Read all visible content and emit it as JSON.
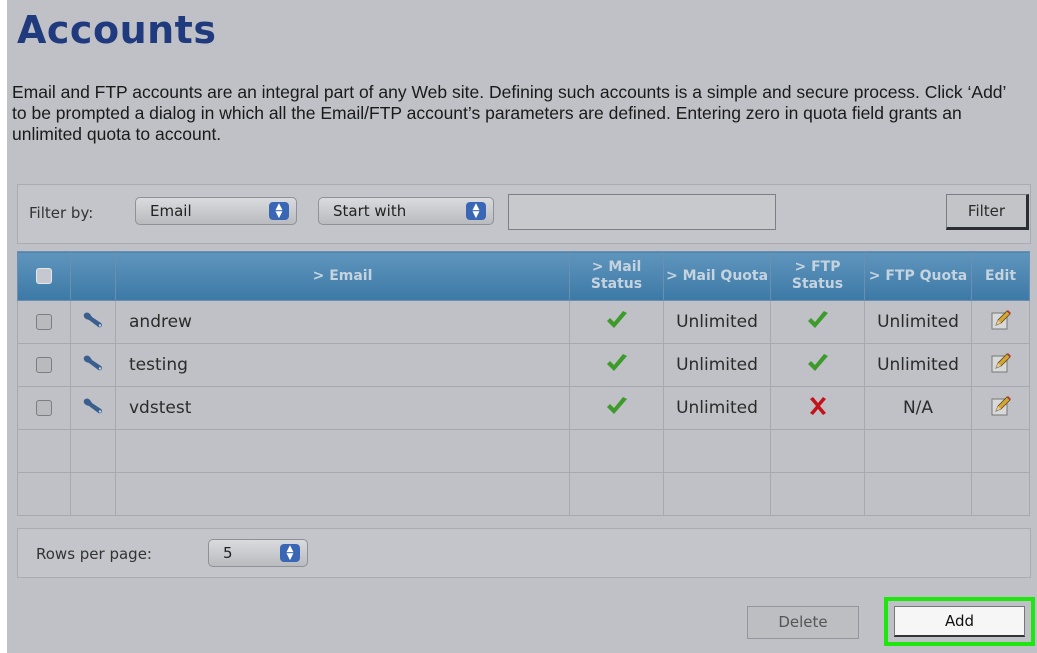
{
  "page": {
    "title": "Accounts",
    "intro": "Email and FTP accounts are an integral part of any Web site. Defining such accounts is a simple and secure process. Click ‘Add’ to be prompted a dialog in which all the Email/FTP account’s parameters are defined. Entering zero in quota field grants an unlimited quota to account."
  },
  "filter": {
    "label": "Filter by:",
    "field_select": "Email",
    "mode_select": "Start with",
    "text_value": "",
    "button_label": "Filter"
  },
  "table": {
    "headers": {
      "email": "Email",
      "mail_status": "Mail Status",
      "mail_quota": "Mail Quota",
      "ftp_status": "FTP Status",
      "ftp_quota": "FTP Quota",
      "edit": "Edit"
    },
    "rows": [
      {
        "name": "andrew",
        "mail_status": "ok",
        "mail_quota": "Unlimited",
        "ftp_status": "ok",
        "ftp_quota": "Unlimited"
      },
      {
        "name": "testing",
        "mail_status": "ok",
        "mail_quota": "Unlimited",
        "ftp_status": "ok",
        "ftp_quota": "Unlimited"
      },
      {
        "name": "vdstest",
        "mail_status": "ok",
        "mail_quota": "Unlimited",
        "ftp_status": "error",
        "ftp_quota": "N/A"
      }
    ]
  },
  "pagination": {
    "rows_label": "Rows per page:",
    "rows_value": "5"
  },
  "actions": {
    "delete_label": "Delete",
    "add_label": "Add"
  },
  "icons": {
    "check": "check-icon",
    "cross": "cross-icon",
    "wrench": "wrench-icon",
    "pencil": "pencil-icon",
    "arrows": "updown-arrows-icon"
  },
  "colors": {
    "title": "#1f3a7d",
    "header": "#4a84ae",
    "check": "#3e9a2b",
    "cross": "#c2131a",
    "highlight": "#1ee60f"
  }
}
